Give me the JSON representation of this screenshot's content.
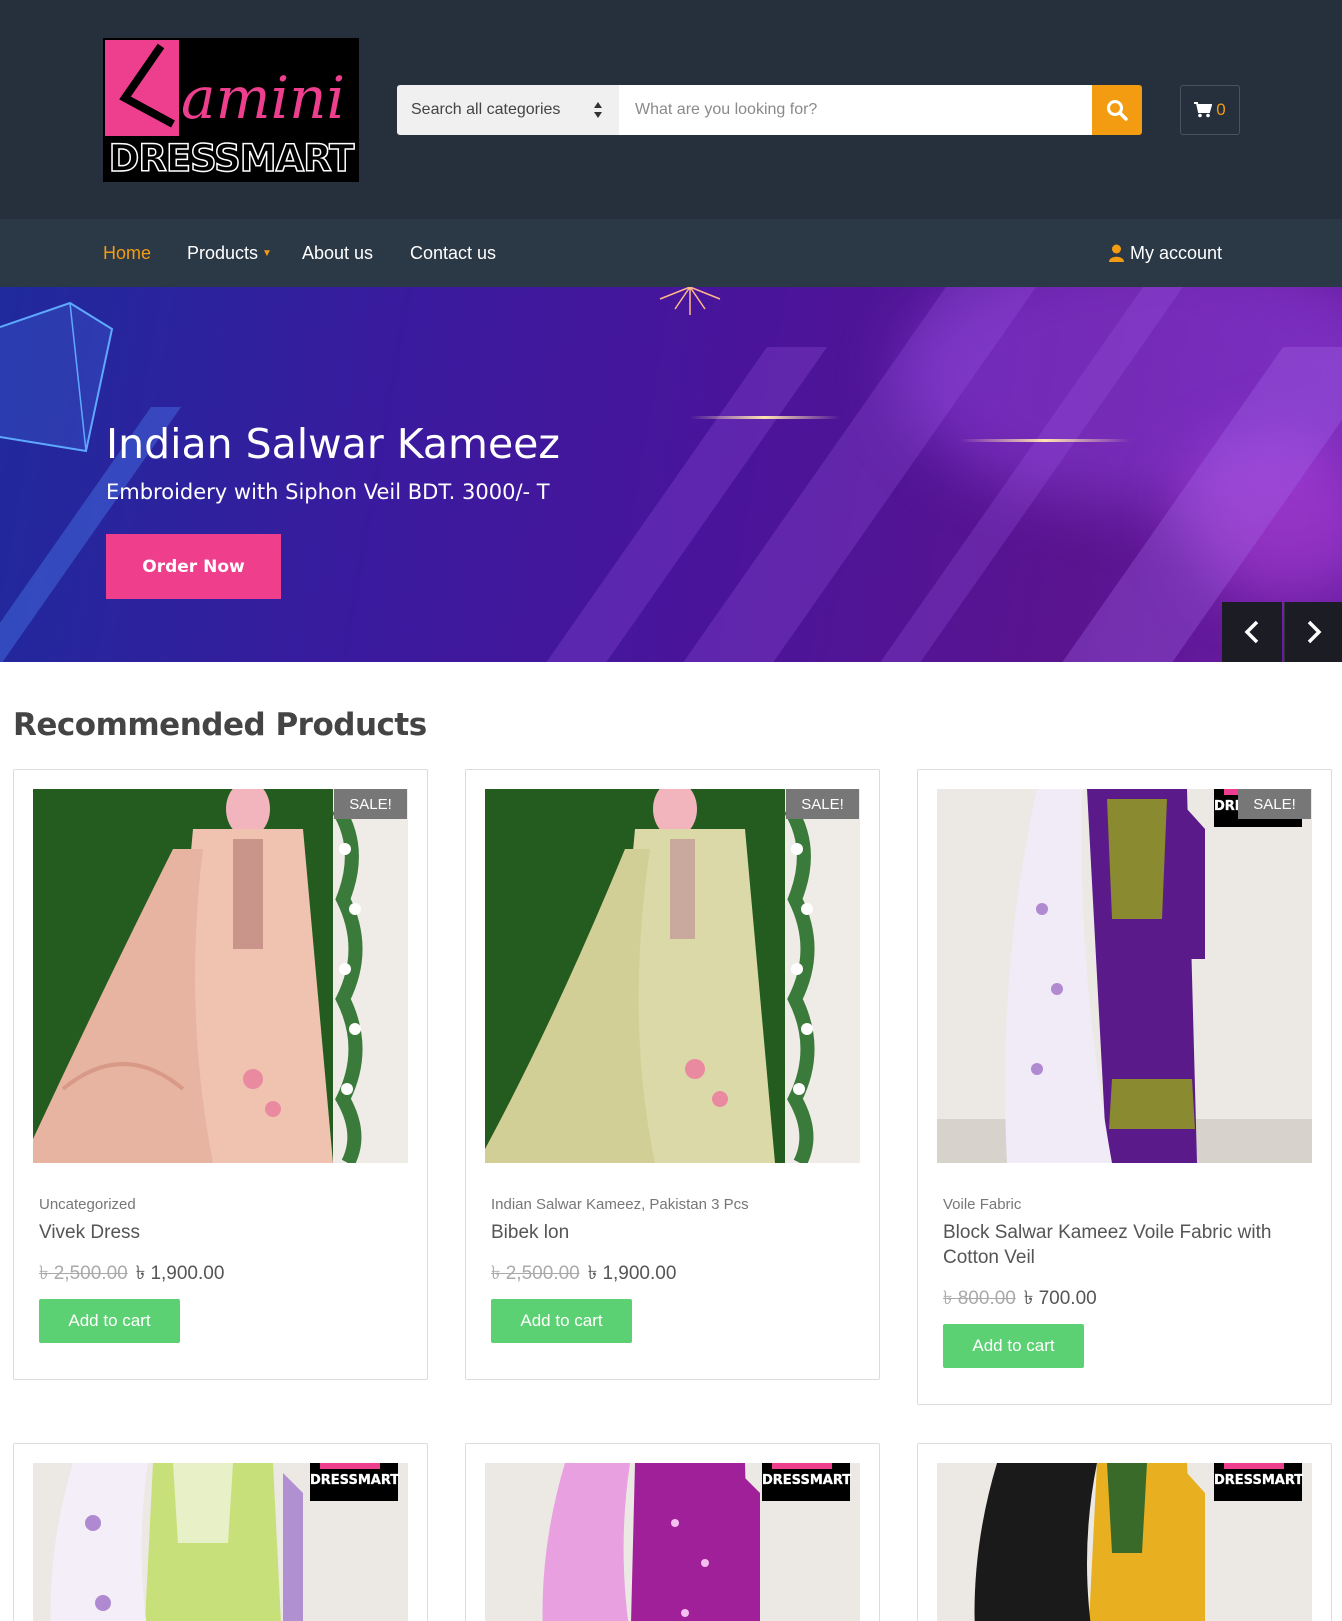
{
  "brand": {
    "logo_script": "Kamini",
    "logo_text": "DRESSMART",
    "accent": "#f39c12",
    "brand_pink": "#ee3f8e"
  },
  "search": {
    "category_label": "Search all categories",
    "placeholder": "What are you looking for?"
  },
  "cart": {
    "count": "0"
  },
  "nav": {
    "items": [
      {
        "label": "Home",
        "active": true
      },
      {
        "label": "Products",
        "has_dropdown": true
      },
      {
        "label": "About us"
      },
      {
        "label": "Contact us"
      }
    ],
    "account_label": "My account"
  },
  "hero": {
    "title": "Indian Salwar Kameez",
    "subtitle": "Embroidery with Siphon Veil BDT. 3000/- T",
    "cta_label": "Order Now"
  },
  "section": {
    "title": "Recommended Products"
  },
  "products": [
    {
      "sale": "SALE!",
      "category": "Uncategorized",
      "name": "Vivek Dress",
      "old_price": "৳ 2,500.00",
      "price": "৳ 1,900.00",
      "button": "Add to cart"
    },
    {
      "sale": "SALE!",
      "category": "Indian Salwar Kameez, Pakistan 3 Pcs",
      "name": "Bibek lon",
      "old_price": "৳ 2,500.00",
      "price": "৳ 1,900.00",
      "button": "Add to cart"
    },
    {
      "sale": "SALE!",
      "category": "Voile Fabric",
      "name": "Block Salwar Kameez Voile Fabric with Cotton Veil",
      "old_price": "৳ 800.00",
      "price": "৳ 700.00",
      "button": "Add to cart"
    }
  ],
  "watermark": "DRESSMART"
}
